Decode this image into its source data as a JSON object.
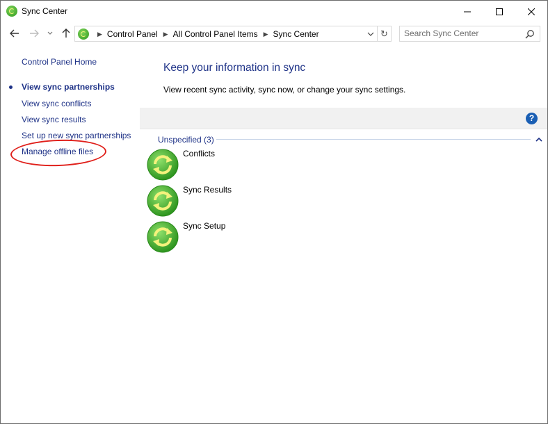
{
  "window": {
    "title": "Sync Center"
  },
  "nav": {
    "crumbs": [
      "Control Panel",
      "All Control Panel Items",
      "Sync Center"
    ],
    "search_placeholder": "Search Sync Center",
    "refresh_glyph": "↻"
  },
  "left": {
    "home": "Control Panel Home",
    "current": "View sync partnerships",
    "conflicts": "View sync conflicts",
    "results": "View sync results",
    "setup": "Set up new sync partnerships",
    "offline": "Manage offline files"
  },
  "main": {
    "heading": "Keep your information in sync",
    "description": "View recent sync activity, sync now, or change your sync settings.",
    "help_glyph": "?",
    "group": "Unspecified (3)",
    "items": [
      {
        "label": "Conflicts",
        "icon": "sync-icon"
      },
      {
        "label": "Sync Results",
        "icon": "sync-icon"
      },
      {
        "label": "Sync Setup",
        "icon": "sync-icon"
      }
    ]
  },
  "colors": {
    "link": "#1e3287",
    "toolbar": "#f1f1f1",
    "highlight": "#e0201b",
    "sync_green": "#3aa52a"
  }
}
